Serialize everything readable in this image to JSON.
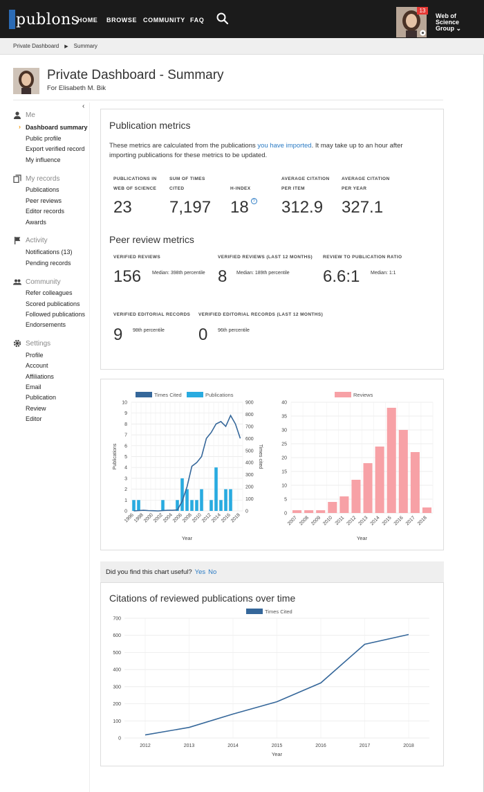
{
  "nav": {
    "logo": "publons",
    "items": [
      "HOME",
      "BROWSE",
      "COMMUNITY",
      "FAQ"
    ],
    "notifications": "13",
    "org_line1": "Web of",
    "org_line2": "Science",
    "org_line3": "Group",
    "org_caret": "⌄"
  },
  "breadcrumb": {
    "root": "Private Dashboard",
    "current": "Summary"
  },
  "header": {
    "title": "Private Dashboard - Summary",
    "subtitle": "For Elisabeth M. Bik"
  },
  "sidebar": {
    "me": {
      "title": "Me",
      "items": [
        "Dashboard summary",
        "Public profile",
        "Export verified record",
        "My influence"
      ]
    },
    "records": {
      "title": "My records",
      "items": [
        "Publications",
        "Peer reviews",
        "Editor records",
        "Awards"
      ]
    },
    "activity": {
      "title": "Activity",
      "items": [
        "Notifications (13)",
        "Pending records"
      ]
    },
    "community": {
      "title": "Community",
      "items": [
        "Refer colleagues",
        "Scored publications",
        "Followed publications",
        "Endorsements"
      ]
    },
    "settings": {
      "title": "Settings",
      "items": [
        "Profile",
        "Account",
        "Affiliations",
        "Email",
        "Publication",
        "Review",
        "Editor"
      ]
    }
  },
  "pub_metrics": {
    "title": "Publication metrics",
    "desc_pre": "These metrics are calculated from the publications ",
    "desc_link": "you have imported",
    "desc_post": ".  It may take up to an hour after importing publications for these metrics to be updated.",
    "labels": [
      "PUBLICATIONS IN WEB OF SCIENCE",
      "SUM OF TIMES CITED",
      "H-INDEX",
      "AVERAGE CITATION PER ITEM",
      "AVERAGE CITATION PER YEAR"
    ],
    "values": [
      "23",
      "7,197",
      "18",
      "312.9",
      "327.1"
    ]
  },
  "peer_metrics": {
    "title": "Peer review metrics",
    "labels": [
      "VERIFIED REVIEWS",
      "VERIFIED REVIEWS (LAST 12 MONTHS)",
      "REVIEW TO PUBLICATION RATIO",
      "VERIFIED EDITORIAL RECORDS",
      "VERIFIED EDITORIAL RECORDS (LAST 12 MONTHS)"
    ],
    "values": [
      "156",
      "8",
      "6.6:1",
      "9",
      "0"
    ],
    "notes": [
      "Median: 398th percentile",
      "Median: 189th percentile",
      "Median: 1:1",
      "98th percentile",
      "96th percentile"
    ]
  },
  "useful": {
    "question": "Did you find this chart useful?",
    "yes": "Yes",
    "no": "No"
  },
  "colors": {
    "navy": "#35679a",
    "cyan": "#29abe0",
    "pink": "#f7a1a6"
  },
  "chart_data": [
    {
      "type": "bar",
      "legend": [
        "Times Cited",
        "Publications"
      ],
      "categories": [
        "1996",
        "1997",
        "1998",
        "1999",
        "2000",
        "2001",
        "2002",
        "2003",
        "2004",
        "2005",
        "2006",
        "2007",
        "2008",
        "2009",
        "2010",
        "2011",
        "2012",
        "2013",
        "2014",
        "2015",
        "2016",
        "2017",
        "2018"
      ],
      "series": [
        {
          "name": "Publications",
          "values": [
            1,
            1,
            0,
            0,
            0,
            0,
            1,
            0,
            0,
            1,
            3,
            2,
            1,
            1,
            2,
            0,
            1,
            4,
            1,
            2,
            2,
            0,
            0
          ]
        },
        {
          "name": "Times Cited",
          "type": "line",
          "values": [
            0,
            3,
            5,
            3,
            2,
            0,
            3,
            5,
            5,
            8,
            80,
            200,
            370,
            400,
            450,
            600,
            650,
            720,
            740,
            700,
            790,
            720,
            600
          ]
        }
      ],
      "xlabel": "Year",
      "ylabel": "Publications",
      "y2label": "Times cited",
      "ylim": [
        0,
        10
      ],
      "y2lim": [
        0,
        900
      ],
      "xticks": [
        "1996",
        "1998",
        "2000",
        "2002",
        "2004",
        "2006",
        "2008",
        "2010",
        "2012",
        "2014",
        "2016",
        "2018"
      ]
    },
    {
      "type": "bar",
      "legend": [
        "Reviews"
      ],
      "categories": [
        "2007",
        "2008",
        "2009",
        "2010",
        "2011",
        "2012",
        "2013",
        "2014",
        "2015",
        "2016",
        "2017",
        "2018"
      ],
      "series": [
        {
          "name": "Reviews",
          "values": [
            1,
            1,
            1,
            4,
            6,
            12,
            18,
            24,
            38,
            30,
            22,
            2
          ]
        }
      ],
      "xlabel": "Year",
      "ylim": [
        0,
        40
      ]
    },
    {
      "type": "line",
      "title": "Citations of reviewed publications over time",
      "legend": [
        "Times Cited"
      ],
      "categories": [
        "2012",
        "2013",
        "2014",
        "2015",
        "2016",
        "2017",
        "2018"
      ],
      "series": [
        {
          "name": "Times Cited",
          "values": [
            18,
            62,
            140,
            212,
            322,
            548,
            605
          ]
        }
      ],
      "xlabel": "Year",
      "ylim": [
        0,
        700
      ]
    }
  ]
}
